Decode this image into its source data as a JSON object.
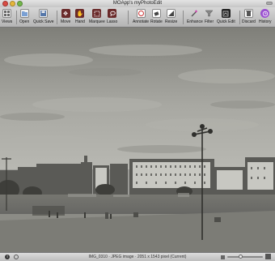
{
  "window": {
    "title": "MOApp's myPhotoEdit"
  },
  "toolbar": {
    "views": "Views",
    "open": "Open",
    "quick_save": "Quick Save",
    "move": "Move",
    "hand": "Hand",
    "marquee": "Marquee",
    "lasso": "Lasso",
    "annotate": "Annotate",
    "rotate": "Rotate",
    "resize": "Resize",
    "enhance": "Enhance",
    "filter": "Filter",
    "quick_edit": "Quick Edit",
    "discard": "Discard",
    "history": "History"
  },
  "status": {
    "text": "IMG_0310 · JPEG image · 2051 x 1543 pixel (Current)"
  },
  "colors": {
    "photo_tint": "#8a8a80",
    "sky": "#b4b4ae",
    "water": "#6e6e68"
  }
}
